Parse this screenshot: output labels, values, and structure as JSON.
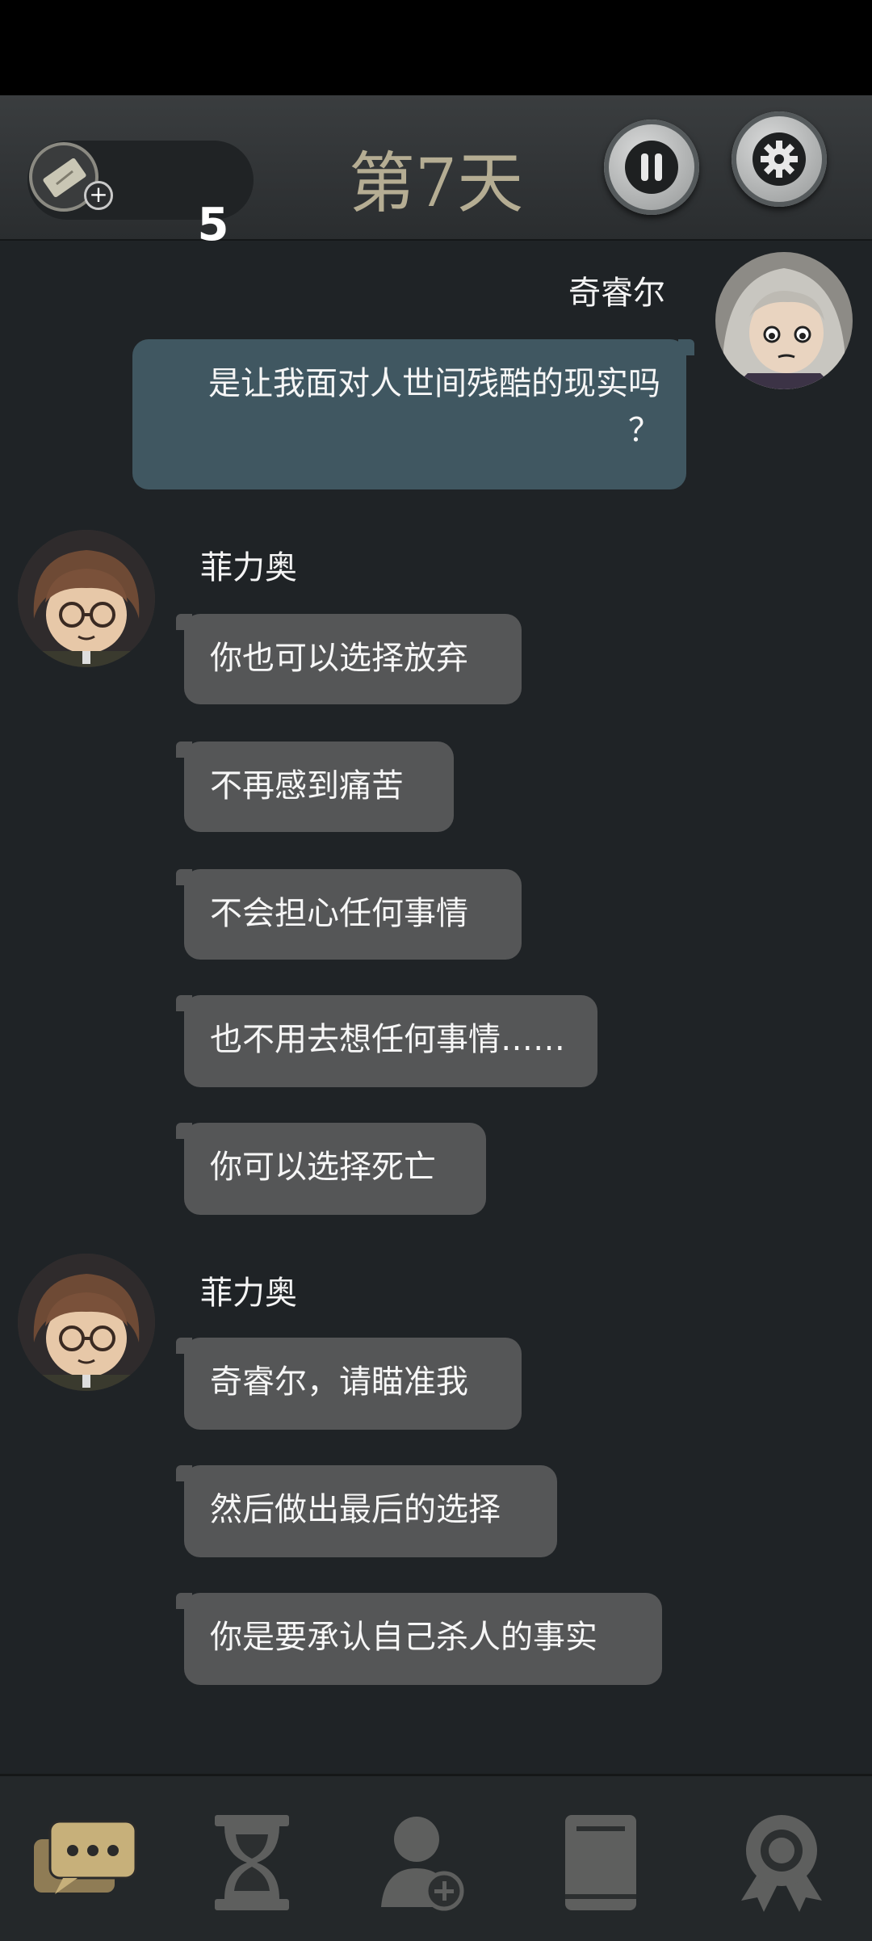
{
  "header": {
    "ticket_count": "5",
    "day_label": "第7天"
  },
  "messages": [
    {
      "side": "right",
      "speaker": "奇睿尔",
      "lines": [
        "是让我面对人世间残酷的现实吗",
        "？"
      ]
    },
    {
      "side": "left",
      "speaker": "菲力奥",
      "texts": [
        "你也可以选择放弃",
        "不再感到痛苦",
        "不会担心任何事情",
        "也不用去想任何事情……",
        "你可以选择死亡"
      ]
    },
    {
      "side": "left",
      "speaker": "菲力奥",
      "texts": [
        "奇睿尔，请瞄准我",
        "然后做出最后的选择",
        "你是要承认自己杀人的事实"
      ]
    }
  ],
  "colors": {
    "day_title": "#b5ad93",
    "bubble_right": "#405761",
    "bubble_left": "#555657",
    "nav_active": "#c7b07a",
    "nav_inactive": "#5e5f5e"
  },
  "icons": {
    "ticket": "ticket-icon",
    "pause": "pause-icon",
    "settings": "gear-icon",
    "nav": [
      "chat-icon",
      "hourglass-icon",
      "add-contact-icon",
      "book-icon",
      "achievement-icon"
    ]
  }
}
